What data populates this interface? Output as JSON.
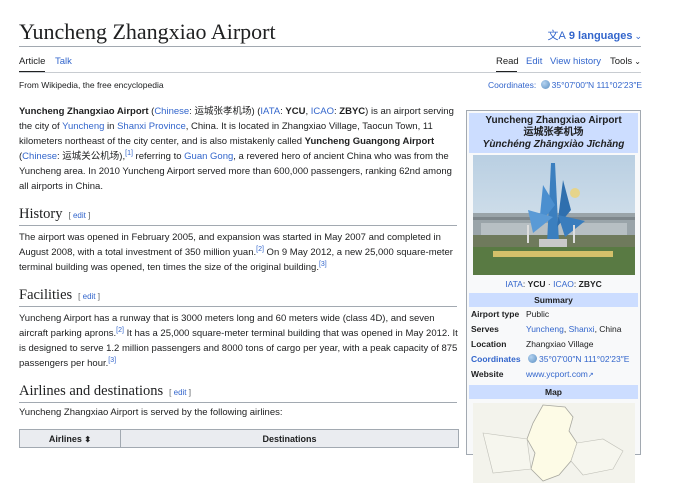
{
  "header": {
    "title": "Yuncheng Zhangxiao Airport",
    "languages_label": "9 languages",
    "languages_glyph": "文A",
    "tabs_left": [
      {
        "label": "Article",
        "active": true
      },
      {
        "label": "Talk",
        "active": false
      }
    ],
    "tabs_right": [
      {
        "label": "Read",
        "active": true
      },
      {
        "label": "Edit",
        "active": false
      },
      {
        "label": "View history",
        "active": false
      },
      {
        "label": "Tools",
        "active": false
      }
    ],
    "tagline": "From Wikipedia, the free encyclopedia",
    "coordinates_label": "Coordinates:",
    "coordinates_value": "35°07′00″N 111°02′23″E"
  },
  "intro": {
    "t1": "Yuncheng Zhangxiao Airport",
    "t2": " (",
    "l1": "Chinese",
    "t3": ": 运城张孝机场) (",
    "l2": "IATA",
    "t4": ": ",
    "t5": "YCU",
    "t6": ", ",
    "l3": "ICAO",
    "t7": ": ",
    "t8": "ZBYC",
    "t9": ") is an airport serving the city of ",
    "l4": "Yuncheng",
    "t10": " in ",
    "l5": "Shanxi Province",
    "t11": ", China. It is located in Zhangxiao Village, Taocun Town, 11 kilometers northeast of the city center, and is also mistakenly called ",
    "t12": "Yuncheng Guangong Airport",
    "t13": " (",
    "l6": "Chinese",
    "t14": ": 运城关公机场),",
    "ref1": "[1]",
    "t15": " referring to ",
    "l7": "Guan Gong",
    "t16": ", a revered hero of ancient China who was from the Yuncheng area. In 2010 Yuncheng Airport served more than 600,000 passengers, ranking 62nd among all airports in China."
  },
  "history": {
    "heading": "History",
    "edit_label": "edit",
    "t1": "The airport was opened in February 2005, and expansion was started in May 2007 and completed in August 2008, with a total investment of 350 million yuan.",
    "ref1": "[2]",
    "t2": " On 9 May 2012, a new 25,000 square-meter terminal building was opened, ten times the size of the original building.",
    "ref2": "[3]"
  },
  "facilities": {
    "heading": "Facilities",
    "edit_label": "edit",
    "t1": "Yuncheng Airport has a runway that is 3000 meters long and 60 meters wide (class 4D), and seven aircraft parking aprons.",
    "ref1": "[2]",
    "t2": " It has a 25,000 square-meter terminal building that was opened in May 2012. It is designed to serve 1.2 million passengers and 8000 tons of cargo per year, with a peak capacity of 875 passengers per hour.",
    "ref2": "[3]"
  },
  "airlines": {
    "heading": "Airlines and destinations",
    "edit_label": "edit",
    "text": "Yuncheng Zhangxiao Airport is served by the following airlines:",
    "columns": [
      "Airlines",
      "Destinations"
    ],
    "sort_glyph": "⬍"
  },
  "infobox": {
    "title_en": "Yuncheng Zhangxiao Airport",
    "title_zh": "运城张孝机场",
    "title_pinyin": "Yùnchéng Zhāngxiào Jīchǎng",
    "iata_label": "IATA",
    "iata": "YCU",
    "separator": " · ",
    "icao_label": "ICAO",
    "icao": "ZBYC",
    "summary_header": "Summary",
    "rows": {
      "type_key": "Airport type",
      "type_val": "Public",
      "serves_key": "Serves",
      "serves_1": "Yuncheng",
      "serves_sep": ", ",
      "serves_2": "Shanxi",
      "serves_3": ", China",
      "location_key": "Location",
      "location_val": "Zhangxiao Village",
      "coords_key": "Coordinates",
      "coords_val": "35°07′00″N 111°02′23″E",
      "website_key": "Website",
      "website_val": "www.ycport.com",
      "website_glyph": "↗"
    },
    "map_header": "Map"
  }
}
